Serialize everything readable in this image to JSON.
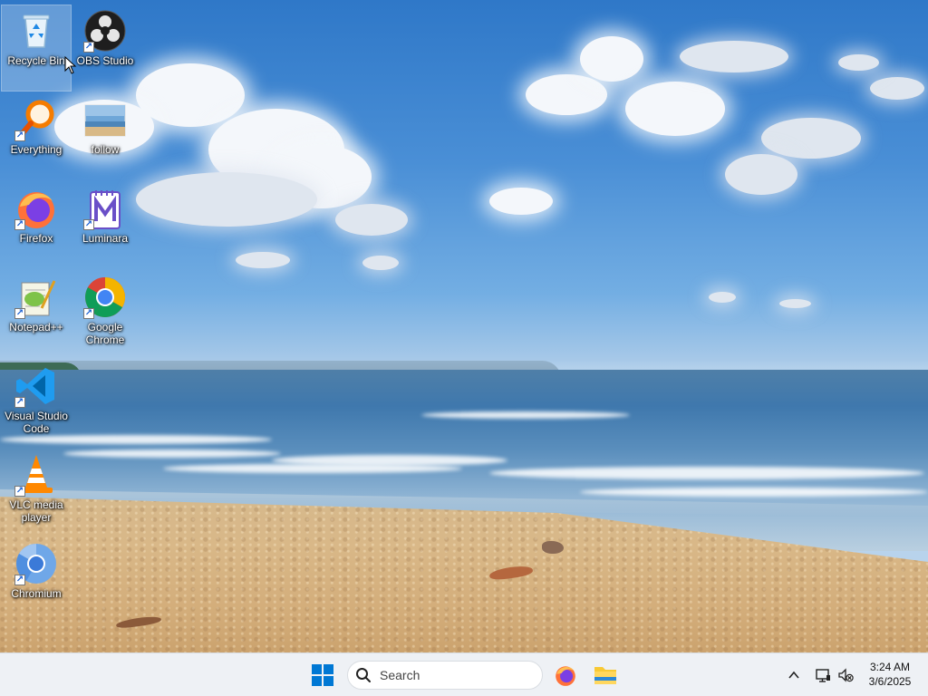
{
  "desktop": {
    "icons": [
      {
        "label": "Recycle Bin",
        "icon": "recycle-bin-icon"
      },
      {
        "label": "OBS Studio",
        "icon": "obs-studio-icon"
      },
      {
        "label": "Everything",
        "icon": "everything-search-icon"
      },
      {
        "label": "follow",
        "icon": "image-file-icon"
      },
      {
        "label": "Firefox",
        "icon": "firefox-icon"
      },
      {
        "label": "Luminara",
        "icon": "luminara-icon"
      },
      {
        "label": "Notepad++",
        "icon": "notepad-plus-plus-icon"
      },
      {
        "label": "Google Chrome",
        "icon": "google-chrome-icon"
      },
      {
        "label": "Visual Studio Code",
        "icon": "vscode-icon"
      },
      {
        "label": "VLC media player",
        "icon": "vlc-icon"
      },
      {
        "label": "Chromium",
        "icon": "chromium-icon"
      }
    ],
    "selected_icon": "Recycle Bin"
  },
  "taskbar": {
    "search_placeholder": "Search",
    "pinned": [
      {
        "name": "Firefox",
        "icon": "firefox-icon"
      },
      {
        "name": "File Explorer",
        "icon": "folder-icon"
      }
    ],
    "tray": {
      "icons": [
        "chevron-up-icon",
        "network-icon",
        "volume-muted-icon"
      ]
    },
    "clock": {
      "time": "3:24 AM",
      "date": "3/6/2025"
    }
  },
  "colors": {
    "accent": "#0067c0",
    "taskbar_bg": "#eef1f5"
  }
}
